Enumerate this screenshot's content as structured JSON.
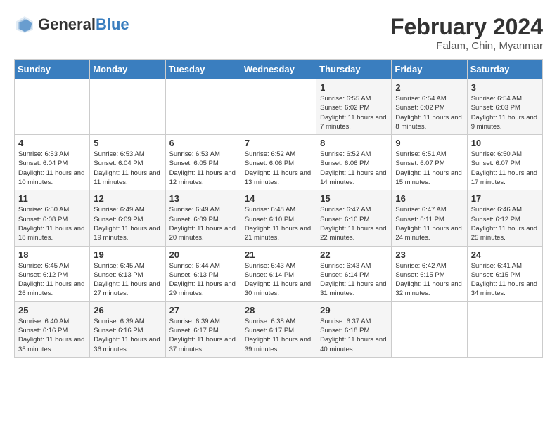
{
  "header": {
    "logo_general": "General",
    "logo_blue": "Blue",
    "month_year": "February 2024",
    "location": "Falam, Chin, Myanmar"
  },
  "weekdays": [
    "Sunday",
    "Monday",
    "Tuesday",
    "Wednesday",
    "Thursday",
    "Friday",
    "Saturday"
  ],
  "weeks": [
    [
      {
        "day": "",
        "info": ""
      },
      {
        "day": "",
        "info": ""
      },
      {
        "day": "",
        "info": ""
      },
      {
        "day": "",
        "info": ""
      },
      {
        "day": "1",
        "info": "Sunrise: 6:55 AM\nSunset: 6:02 PM\nDaylight: 11 hours and 7 minutes."
      },
      {
        "day": "2",
        "info": "Sunrise: 6:54 AM\nSunset: 6:02 PM\nDaylight: 11 hours and 8 minutes."
      },
      {
        "day": "3",
        "info": "Sunrise: 6:54 AM\nSunset: 6:03 PM\nDaylight: 11 hours and 9 minutes."
      }
    ],
    [
      {
        "day": "4",
        "info": "Sunrise: 6:53 AM\nSunset: 6:04 PM\nDaylight: 11 hours and 10 minutes."
      },
      {
        "day": "5",
        "info": "Sunrise: 6:53 AM\nSunset: 6:04 PM\nDaylight: 11 hours and 11 minutes."
      },
      {
        "day": "6",
        "info": "Sunrise: 6:53 AM\nSunset: 6:05 PM\nDaylight: 11 hours and 12 minutes."
      },
      {
        "day": "7",
        "info": "Sunrise: 6:52 AM\nSunset: 6:06 PM\nDaylight: 11 hours and 13 minutes."
      },
      {
        "day": "8",
        "info": "Sunrise: 6:52 AM\nSunset: 6:06 PM\nDaylight: 11 hours and 14 minutes."
      },
      {
        "day": "9",
        "info": "Sunrise: 6:51 AM\nSunset: 6:07 PM\nDaylight: 11 hours and 15 minutes."
      },
      {
        "day": "10",
        "info": "Sunrise: 6:50 AM\nSunset: 6:07 PM\nDaylight: 11 hours and 17 minutes."
      }
    ],
    [
      {
        "day": "11",
        "info": "Sunrise: 6:50 AM\nSunset: 6:08 PM\nDaylight: 11 hours and 18 minutes."
      },
      {
        "day": "12",
        "info": "Sunrise: 6:49 AM\nSunset: 6:09 PM\nDaylight: 11 hours and 19 minutes."
      },
      {
        "day": "13",
        "info": "Sunrise: 6:49 AM\nSunset: 6:09 PM\nDaylight: 11 hours and 20 minutes."
      },
      {
        "day": "14",
        "info": "Sunrise: 6:48 AM\nSunset: 6:10 PM\nDaylight: 11 hours and 21 minutes."
      },
      {
        "day": "15",
        "info": "Sunrise: 6:47 AM\nSunset: 6:10 PM\nDaylight: 11 hours and 22 minutes."
      },
      {
        "day": "16",
        "info": "Sunrise: 6:47 AM\nSunset: 6:11 PM\nDaylight: 11 hours and 24 minutes."
      },
      {
        "day": "17",
        "info": "Sunrise: 6:46 AM\nSunset: 6:12 PM\nDaylight: 11 hours and 25 minutes."
      }
    ],
    [
      {
        "day": "18",
        "info": "Sunrise: 6:45 AM\nSunset: 6:12 PM\nDaylight: 11 hours and 26 minutes."
      },
      {
        "day": "19",
        "info": "Sunrise: 6:45 AM\nSunset: 6:13 PM\nDaylight: 11 hours and 27 minutes."
      },
      {
        "day": "20",
        "info": "Sunrise: 6:44 AM\nSunset: 6:13 PM\nDaylight: 11 hours and 29 minutes."
      },
      {
        "day": "21",
        "info": "Sunrise: 6:43 AM\nSunset: 6:14 PM\nDaylight: 11 hours and 30 minutes."
      },
      {
        "day": "22",
        "info": "Sunrise: 6:43 AM\nSunset: 6:14 PM\nDaylight: 11 hours and 31 minutes."
      },
      {
        "day": "23",
        "info": "Sunrise: 6:42 AM\nSunset: 6:15 PM\nDaylight: 11 hours and 32 minutes."
      },
      {
        "day": "24",
        "info": "Sunrise: 6:41 AM\nSunset: 6:15 PM\nDaylight: 11 hours and 34 minutes."
      }
    ],
    [
      {
        "day": "25",
        "info": "Sunrise: 6:40 AM\nSunset: 6:16 PM\nDaylight: 11 hours and 35 minutes."
      },
      {
        "day": "26",
        "info": "Sunrise: 6:39 AM\nSunset: 6:16 PM\nDaylight: 11 hours and 36 minutes."
      },
      {
        "day": "27",
        "info": "Sunrise: 6:39 AM\nSunset: 6:17 PM\nDaylight: 11 hours and 37 minutes."
      },
      {
        "day": "28",
        "info": "Sunrise: 6:38 AM\nSunset: 6:17 PM\nDaylight: 11 hours and 39 minutes."
      },
      {
        "day": "29",
        "info": "Sunrise: 6:37 AM\nSunset: 6:18 PM\nDaylight: 11 hours and 40 minutes."
      },
      {
        "day": "",
        "info": ""
      },
      {
        "day": "",
        "info": ""
      }
    ]
  ]
}
